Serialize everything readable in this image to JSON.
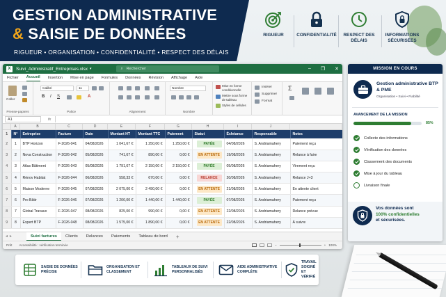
{
  "banner": {
    "title_line1": "GESTION ADMINISTRATIVE",
    "title_amp": "&",
    "title_line2": "SAISIE DE DONNÉES",
    "tagline": "RIGUEUR  •  ORGANISATION  •  CONFIDENTIALITÉ  •  RESPECT DES DÉLAIS"
  },
  "features": [
    {
      "icon": "target-icon",
      "label": "RIGUEUR"
    },
    {
      "icon": "lock-icon",
      "label": "CONFIDENTIALITÉ"
    },
    {
      "icon": "clock-icon",
      "label": "RESPECT DES DÉLAIS"
    },
    {
      "icon": "shield-lock-icon",
      "label": "INFORMATIONS SÉCURISÉES"
    }
  ],
  "excel": {
    "filename": "Suivi_Administratif_Entreprises.xlsx",
    "search_placeholder": "Rechercher",
    "menu": [
      "Fichier",
      "Accueil",
      "Insertion",
      "Mise en page",
      "Formules",
      "Données",
      "Révision",
      "Affichage",
      "Aide"
    ],
    "ribbon": {
      "clipboard": {
        "paste": "Coller",
        "group": "Presse-papiers"
      },
      "font": {
        "name": "Calibri",
        "size": "11",
        "group": "Police"
      },
      "alignment": {
        "group": "Alignement"
      },
      "number": {
        "format": "Nombre",
        "group": "Nombre"
      },
      "styles": {
        "cond": "Mise en forme conditionnelle",
        "table": "Mettre sous forme de tableau",
        "cell": "Styles de cellules",
        "group": "Styles"
      },
      "cells": {
        "insert": "Insérer",
        "delete": "Supprimer",
        "format": "Format",
        "group": "Cellules"
      },
      "editing": {
        "group": "Édition"
      }
    },
    "name_box": "A1",
    "fx": "fx",
    "col_letters": [
      "A",
      "B",
      "C",
      "D",
      "E",
      "F",
      "G",
      "H",
      "I",
      "J"
    ],
    "headers": [
      "N°",
      "Entreprise",
      "Facture",
      "Date",
      "Montant HT",
      "Montant TTC",
      "Paiement",
      "Statut",
      "Échéance",
      "Responsable",
      "Notes"
    ],
    "rows": [
      {
        "rn": "2",
        "n": "1",
        "ent": "BTP Horizon",
        "fac": "F-2026-041",
        "date": "04/08/2026",
        "ht": "1 041,67 €",
        "ttc": "1 250,00 €",
        "pay": "1 250,00 €",
        "statut": "PAYÉE",
        "ech": "04/08/2026",
        "resp": "S. Andriamahery",
        "notes": "Paiement reçu"
      },
      {
        "rn": "3",
        "n": "2",
        "ent": "Nova Construction",
        "fac": "F-2026-042",
        "date": "05/08/2026",
        "ht": "741,67 €",
        "ttc": "890,00 €",
        "pay": "0,00 €",
        "statut": "EN ATTENTE",
        "ech": "19/08/2026",
        "resp": "S. Andriamahery",
        "notes": "Relance à faire"
      },
      {
        "rn": "4",
        "n": "3",
        "ent": "Atlas Bâtiment",
        "fac": "F-2026-043",
        "date": "05/08/2026",
        "ht": "1 791,67 €",
        "ttc": "2 150,00 €",
        "pay": "2 150,00 €",
        "statut": "PAYÉE",
        "ech": "05/08/2026",
        "resp": "S. Andriamahery",
        "notes": "Virement reçu"
      },
      {
        "rn": "5",
        "n": "4",
        "ent": "Rénov Habitat",
        "fac": "F-2026-044",
        "date": "06/08/2026",
        "ht": "558,33 €",
        "ttc": "670,00 €",
        "pay": "0,00 €",
        "statut": "RELANCE",
        "ech": "20/08/2026",
        "resp": "S. Andriamahery",
        "notes": "Relance J+3"
      },
      {
        "rn": "6",
        "n": "5",
        "ent": "Maison Moderne",
        "fac": "F-2026-045",
        "date": "07/08/2026",
        "ht": "2 075,00 €",
        "ttc": "2 490,00 €",
        "pay": "0,00 €",
        "statut": "EN ATTENTE",
        "ech": "21/08/2026",
        "resp": "S. Andriamahery",
        "notes": "En attente client"
      },
      {
        "rn": "7",
        "n": "6",
        "ent": "Pro Bâtir",
        "fac": "F-2026-046",
        "date": "07/08/2026",
        "ht": "1 200,00 €",
        "ttc": "1 440,00 €",
        "pay": "1 440,00 €",
        "statut": "PAYÉE",
        "ech": "07/08/2026",
        "resp": "S. Andriamahery",
        "notes": "Paiement reçu"
      },
      {
        "rn": "8",
        "n": "7",
        "ent": "Global Travaux",
        "fac": "F-2026-047",
        "date": "08/08/2026",
        "ht": "825,00 €",
        "ttc": "990,00 €",
        "pay": "0,00 €",
        "statut": "EN ATTENTE",
        "ech": "22/08/2026",
        "resp": "S. Andriamahery",
        "notes": "Relance prévue"
      },
      {
        "rn": "9",
        "n": "8",
        "ent": "Expert BTP",
        "fac": "F-2026-048",
        "date": "08/08/2026",
        "ht": "1 575,00 €",
        "ttc": "1 890,00 €",
        "pay": "0,00 €",
        "statut": "EN ATTENTE",
        "ech": "22/08/2026",
        "resp": "S. Andriamahery",
        "notes": "À suivre"
      }
    ],
    "sheets": [
      "Suivi factures",
      "Clients",
      "Relances",
      "Paiements",
      "Tableau de bord"
    ],
    "status_left": "Prêt",
    "status_access": "Accessibilité : vérification terminée",
    "zoom": "100%"
  },
  "mission": {
    "header": "MISSION EN COURS",
    "title": "Gestion administrative BTP & PME",
    "subtitle": "Organisation • Suivi • Fiabilité",
    "progress_label": "AVANCEMENT DE LA MISSION",
    "progress_value": 85,
    "progress_text": "85%",
    "tasks": [
      {
        "label": "Collecte des informations",
        "done": true
      },
      {
        "label": "Vérification des données",
        "done": true
      },
      {
        "label": "Classement des documents",
        "done": true
      },
      {
        "label": "Mise à jour du tableau",
        "done": true
      },
      {
        "label": "Livraison finale",
        "done": false
      }
    ],
    "footer_line1": "Vos données sont",
    "footer_green": "100% confidentielles",
    "footer_line3": "et sécurisées."
  },
  "bottom": [
    {
      "icon": "spreadsheet-icon",
      "label_1": "SAISIE DE DONNÉES",
      "label_2": "PRÉCISE"
    },
    {
      "icon": "folder-icon",
      "label_1": "ORGANISATION ET",
      "label_2": "CLASSEMENT"
    },
    {
      "icon": "bar-chart-icon",
      "label_1": "TABLEAUX DE SUIVI",
      "label_2": "PERSONNALISÉS"
    },
    {
      "icon": "mail-icon",
      "label_1": "AIDE ADMINISTRATIVE",
      "label_2": "COMPLÈTE"
    },
    {
      "icon": "shield-check-icon",
      "label_1": "TRAVAIL SOIGNÉ",
      "label_2": "ET VÉRIFIÉ"
    }
  ],
  "colors": {
    "navy": "#0e2a4f",
    "excel_green": "#1e6e42",
    "accent": "#f2a51a",
    "ok": "#2e7d32"
  }
}
